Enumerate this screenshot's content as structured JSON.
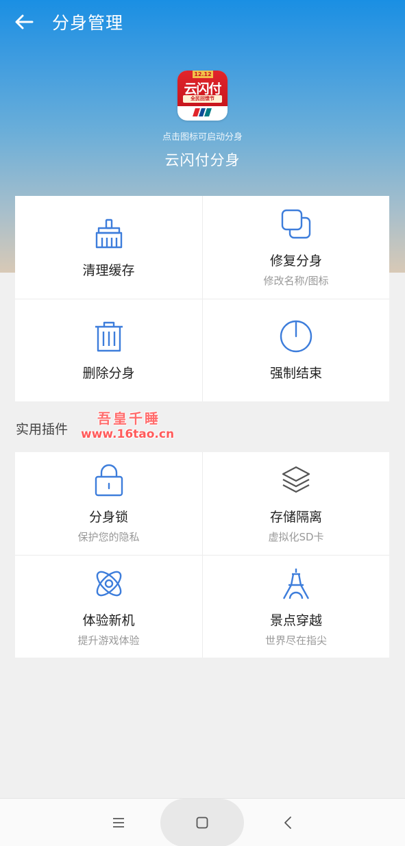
{
  "header": {
    "title": "分身管理",
    "back_icon": "arrow-left-icon"
  },
  "app": {
    "icon_banner": "12.12",
    "icon_text": "云闪付",
    "icon_subtext": "全民回馈节",
    "hint": "点击图标可启动分身",
    "name": "云闪付分身"
  },
  "actions": [
    {
      "label": "清理缓存",
      "sub": "",
      "icon": "broom-icon"
    },
    {
      "label": "修复分身",
      "sub": "修改名称/图标",
      "icon": "copy-squares-icon"
    },
    {
      "label": "删除分身",
      "sub": "",
      "icon": "trash-icon"
    },
    {
      "label": "强制结束",
      "sub": "",
      "icon": "power-icon"
    }
  ],
  "plugins_section": {
    "title": "实用插件",
    "items": [
      {
        "label": "分身锁",
        "sub": "保护您的隐私",
        "icon": "padlock-icon"
      },
      {
        "label": "存储隔离",
        "sub": "虚拟化SD卡",
        "icon": "layers-icon"
      },
      {
        "label": "体验新机",
        "sub": "提升游戏体验",
        "icon": "atom-icon"
      },
      {
        "label": "景点穿越",
        "sub": "世界尽在指尖",
        "icon": "eiffel-tower-icon"
      }
    ]
  },
  "watermark": {
    "line1": "吾皇千睡",
    "line2": "www.16tao.cn"
  },
  "navbar": {
    "menu_icon": "menu-lines-icon",
    "home_icon": "home-square-icon",
    "back_icon": "chevron-left-icon"
  },
  "colors": {
    "accent": "#3d7ddb",
    "header_top": "#1a8fe3",
    "icon_red": "#c8161d",
    "watermark": "#ff5a5a"
  }
}
